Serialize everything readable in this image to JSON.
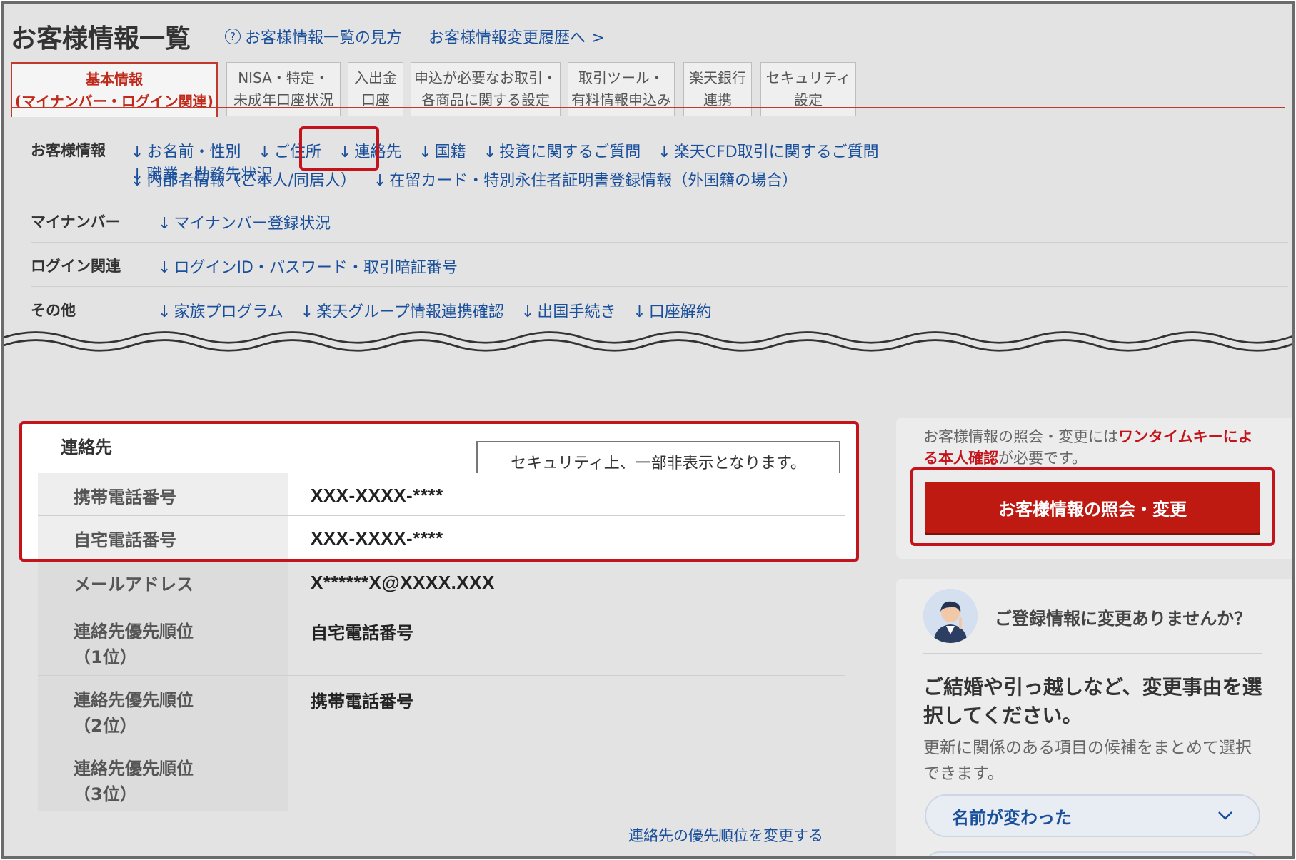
{
  "header": {
    "title": "お客様情報一覧",
    "help_icon": "?",
    "help_link": "お客様情報一覧の見方",
    "history_link": "お客様情報変更履歴へ",
    "history_chevron": ">"
  },
  "tabs": [
    {
      "line1": "基本情報",
      "line2": "(マイナンバー・ログイン関連)",
      "active": true
    },
    {
      "line1": "NISA・特定・",
      "line2": "未成年口座状況",
      "active": false
    },
    {
      "line1": "入出金",
      "line2": "口座",
      "active": false
    },
    {
      "line1": "申込が必要なお取引・",
      "line2": "各商品に関する設定",
      "active": false
    },
    {
      "line1": "取引ツール・",
      "line2": "有料情報申込み",
      "active": false
    },
    {
      "line1": "楽天銀行",
      "line2": "連携",
      "active": false
    },
    {
      "line1": "セキュリティ",
      "line2": "設定",
      "active": false
    }
  ],
  "nav": {
    "arrow": "↓",
    "sections": [
      {
        "label": "お客様情報",
        "links": [
          "お名前・性別",
          "ご住所",
          "連絡先",
          "国籍",
          "投資に関するご質問",
          "楽天CFD取引に関するご質問",
          "職業・勤務先状況"
        ],
        "links2": [
          "内部者情報（ご本人/同居人）",
          "在留カード・特別永住者証明書登録情報（外国籍の場合）"
        ]
      },
      {
        "label": "マイナンバー",
        "links": [
          "マイナンバー登録状況"
        ]
      },
      {
        "label": "ログイン関連",
        "links": [
          "ログインID・パスワード・取引暗証番号"
        ]
      },
      {
        "label": "その他",
        "links": [
          "家族プログラム",
          "楽天グループ情報連携確認",
          "出国手続き",
          "口座解約"
        ]
      }
    ]
  },
  "contact": {
    "title": "連絡先",
    "tooltip": "セキュリティ上、一部非表示となります。",
    "rows": [
      {
        "label": "携帯電話番号",
        "value": "XXX-XXXX-****"
      },
      {
        "label": "自宅電話番号",
        "value": "XXX-XXXX-****"
      },
      {
        "label": "メールアドレス",
        "value": "X******X@XXXX.XXX"
      },
      {
        "label": "連絡先優先順位",
        "sub": "（1位）",
        "value": "自宅電話番号"
      },
      {
        "label": "連絡先優先順位",
        "sub": "（2位）",
        "value": "携帯電話番号"
      },
      {
        "label": "連絡先優先順位",
        "sub": "（3位）",
        "value": ""
      }
    ],
    "priority_link": "連絡先の優先順位を変更する"
  },
  "side": {
    "otk_text_before": "お客様情報の照会・変更には",
    "otk_text_red": "ワンタイムキーによる本人確認",
    "otk_text_after": "が必要です。",
    "main_button": "お客様情報の照会・変更",
    "card2_title": "ご登録情報に変更ありませんか？",
    "card2_heading": "ご結婚や引っ越しなど、変更事由を選択してください。",
    "card2_desc": "更新に関係のある項目の候補をまとめて選択できます。",
    "select_label": "名前が変わった"
  },
  "colors": {
    "accent_red": "#c4141b",
    "link_blue": "#1a4f9c",
    "button_red": "#bf1a12"
  }
}
